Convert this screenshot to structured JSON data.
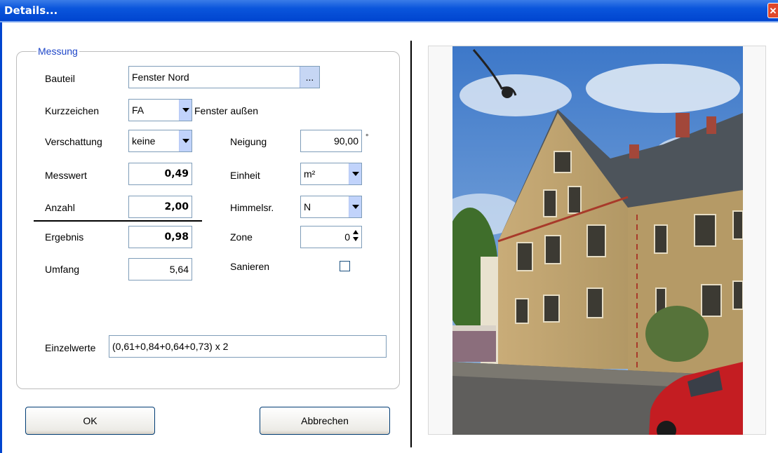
{
  "window": {
    "title": "Details...",
    "close_glyph": "✕"
  },
  "group": {
    "legend": "Messung"
  },
  "fields": {
    "bauteil": {
      "label": "Bauteil",
      "value": "Fenster Nord",
      "button": "..."
    },
    "kurzzeichen": {
      "label": "Kurzzeichen",
      "value": "FA",
      "description": "Fenster außen"
    },
    "verschattung": {
      "label": "Verschattung",
      "value": "keine"
    },
    "neigung": {
      "label": "Neigung",
      "value": "90,00",
      "unit": "°"
    },
    "messwert": {
      "label": "Messwert",
      "value": "0,49"
    },
    "einheit": {
      "label": "Einheit",
      "value": "m²"
    },
    "anzahl": {
      "label": "Anzahl",
      "value": "2,00"
    },
    "himmelsrichtung": {
      "label": "Himmelsr.",
      "value": "N"
    },
    "ergebnis": {
      "label": "Ergebnis",
      "value": "0,98"
    },
    "zone": {
      "label": "Zone",
      "value": "0"
    },
    "umfang": {
      "label": "Umfang",
      "value": "5,64"
    },
    "sanieren": {
      "label": "Sanieren",
      "checked": false
    },
    "einzelwerte": {
      "label": "Einzelwerte",
      "value": "(0,61+0,84+0,64+0,73) x 2"
    }
  },
  "buttons": {
    "ok": "OK",
    "cancel": "Abbrechen"
  },
  "colors": {
    "titlebar": "#0045cf",
    "legend": "#1e46c8",
    "dropdown_button": "#c1d3fb"
  },
  "icons": {
    "close": "close-icon",
    "dropdown": "chevron-down-icon",
    "spinner": "spin-updown-icon"
  }
}
